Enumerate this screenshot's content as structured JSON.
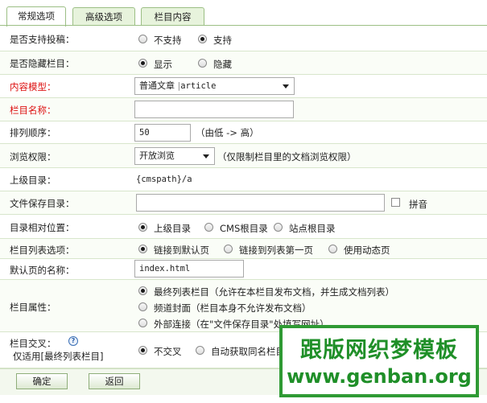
{
  "tabs": [
    "常规选项",
    "高级选项",
    "栏目内容"
  ],
  "rows": {
    "allow_submit": {
      "label": "是否支持投稿：",
      "options": [
        "不支持",
        "支持"
      ],
      "selected": 1
    },
    "hide_column": {
      "label": "是否隐藏栏目：",
      "options": [
        "显示",
        "隐藏"
      ],
      "selected": 0
    },
    "content_model": {
      "label": "内容模型：",
      "value_cn": "普通文章",
      "value_en": "article"
    },
    "column_name": {
      "label": "栏目名称：",
      "value": ""
    },
    "sort_order": {
      "label": "排列顺序：",
      "value": "50",
      "hint": "（由低 -> 高）"
    },
    "browse_perm": {
      "label": "浏览权限：",
      "value": "开放浏览",
      "hint": "（仅限制栏目里的文档浏览权限）"
    },
    "parent_dir": {
      "label": "上级目录：",
      "value": "{cmspath}/a"
    },
    "save_dir": {
      "label": "文件保存目录：",
      "value": "",
      "checkbox_label": "拼音"
    },
    "relative_pos": {
      "label": "目录相对位置：",
      "options": [
        "上级目录",
        "CMS根目录",
        "站点根目录"
      ],
      "selected": 0
    },
    "list_option": {
      "label": "栏目列表选项：",
      "options": [
        "链接到默认页",
        "链接到列表第一页",
        "使用动态页"
      ],
      "selected": 0
    },
    "default_page": {
      "label": "默认页的名称：",
      "value": "index.html"
    },
    "column_attr": {
      "label": "栏目属性：",
      "options": [
        "最终列表栏目（允许在本栏目发布文档，并生成文档列表）",
        "频道封面（栏目本身不允许发布文档）",
        "外部连接（在\"文件保存目录\"处填写网址）"
      ],
      "selected": 0
    },
    "cross": {
      "label": "栏目交叉：",
      "help": "?",
      "sublabel": "仅适用[最终列表栏目]",
      "options": [
        "不交叉",
        "自动获取同名栏目"
      ],
      "selected": 0
    }
  },
  "buttons": {
    "ok": "确定",
    "back": "返回"
  },
  "watermark": {
    "cn": "跟版网织梦模板",
    "url": "www.genban.org"
  },
  "colors": {
    "accent_green": "#2f9a34",
    "required_red": "#dd1111",
    "tab_border": "#9cbf85"
  }
}
